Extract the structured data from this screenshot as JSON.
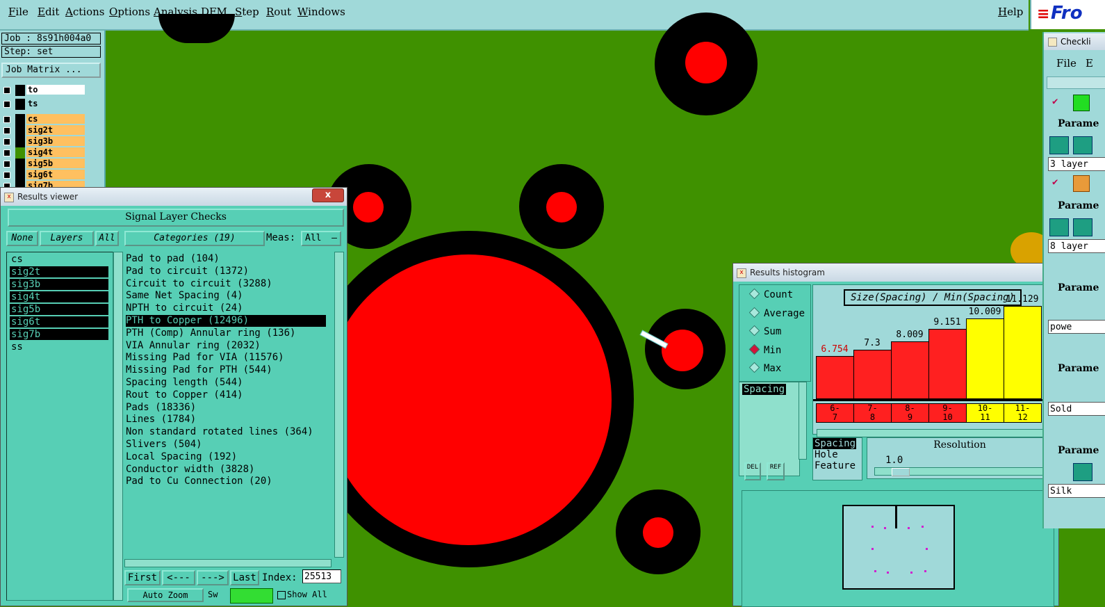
{
  "menu": {
    "items": [
      "File",
      "Edit",
      "Actions",
      "Options",
      "Analysis",
      "DFM",
      "Step",
      "Rout",
      "Windows"
    ],
    "help": "Help"
  },
  "logo": {
    "text": "Fro"
  },
  "job": {
    "job_label": "Job : 8s91h004a0",
    "step_label": "Step: set",
    "matrix_button": "Job Matrix ...",
    "layers": [
      {
        "name": "to",
        "bg": "#ffffff"
      },
      {
        "name": "ts",
        "bg": "#a0d9d9"
      },
      {
        "name": "cs",
        "bg": "#ffc060"
      },
      {
        "name": "sig2t",
        "bg": "#ffc060"
      },
      {
        "name": "sig3b",
        "bg": "#ffc060"
      },
      {
        "name": "sig4t",
        "bg": "#ffc060"
      },
      {
        "name": "sig5b",
        "bg": "#ffc060"
      },
      {
        "name": "sig6t",
        "bg": "#ffc060"
      },
      {
        "name": "sig7b",
        "bg": "#ffc060"
      }
    ]
  },
  "results_viewer": {
    "title": "Results viewer",
    "close": "x",
    "heading": "Signal Layer Checks",
    "none_btn": "None",
    "layers_btn": "Layers",
    "all_btn": "All",
    "categories_btn": "Categories (19)",
    "meas_label": "Meas:",
    "meas_value": "All",
    "layer_list": [
      {
        "name": "cs",
        "selected": false
      },
      {
        "name": "sig2t",
        "selected": true
      },
      {
        "name": "sig3b",
        "selected": true
      },
      {
        "name": "sig4t",
        "selected": true
      },
      {
        "name": "sig5b",
        "selected": true
      },
      {
        "name": "sig6t",
        "selected": true
      },
      {
        "name": "sig7b",
        "selected": true
      },
      {
        "name": "ss",
        "selected": false
      }
    ],
    "categories": [
      {
        "label": "Pad to pad (104)",
        "selected": false
      },
      {
        "label": "Pad to circuit (1372)",
        "selected": false
      },
      {
        "label": "Circuit to circuit (3288)",
        "selected": false
      },
      {
        "label": "Same Net Spacing (4)",
        "selected": false
      },
      {
        "label": "NPTH to circuit (24)",
        "selected": false
      },
      {
        "label": "PTH to Copper (12496)",
        "selected": true
      },
      {
        "label": "PTH (Comp) Annular ring (136)",
        "selected": false
      },
      {
        "label": "VIA Annular ring (2032)",
        "selected": false
      },
      {
        "label": "Missing Pad for VIA (11576)",
        "selected": false
      },
      {
        "label": "Missing Pad for PTH (544)",
        "selected": false
      },
      {
        "label": "Spacing length (544)",
        "selected": false
      },
      {
        "label": "Rout to Copper (414)",
        "selected": false
      },
      {
        "label": "Pads (18336)",
        "selected": false
      },
      {
        "label": "Lines (1784)",
        "selected": false
      },
      {
        "label": "Non standard rotated lines (364)",
        "selected": false
      },
      {
        "label": "Slivers (504)",
        "selected": false
      },
      {
        "label": "Local Spacing (192)",
        "selected": false
      },
      {
        "label": "Conductor width (3828)",
        "selected": false
      },
      {
        "label": "Pad to Cu Connection (20)",
        "selected": false
      }
    ],
    "nav": {
      "first": "First",
      "prev": "<---",
      "next": "--->",
      "last": "Last",
      "index_label": "Index:",
      "index_value": "25513"
    },
    "bottom": {
      "auto_zoom": "Auto Zoom",
      "sw": "Sw",
      "show_all": "Show All"
    }
  },
  "histogram": {
    "title": "Results histogram",
    "close": "x",
    "modes": [
      {
        "label": "Count",
        "on": false
      },
      {
        "label": "Average",
        "on": false
      },
      {
        "label": "Sum",
        "on": false
      },
      {
        "label": "Min",
        "on": true
      },
      {
        "label": "Max",
        "on": false
      }
    ],
    "list_item": "Spacing",
    "del_btn": "DEL",
    "ref_btn": "REF",
    "chart_title": "Size(Spacing) / Min(Spacing)",
    "features": [
      "Spacing",
      "Hole",
      "Feature"
    ],
    "resolution_label": "Resolution",
    "resolution_value": "1.0",
    "colors": {
      "red": "#ff2020",
      "yellow": "#ffff00"
    }
  },
  "chart_data": {
    "type": "bar",
    "title": "Size(Spacing) / Min(Spacing)",
    "categories": [
      "6-7",
      "7-8",
      "8-9",
      "9-10",
      "10-11",
      "11-12"
    ],
    "values": [
      6.754,
      7.3,
      8.009,
      9.151,
      10.009,
      11.129
    ],
    "value_labels": [
      "6.754",
      "7.3",
      "8.009",
      "9.151",
      "10.009",
      "11.129"
    ],
    "bin_labels": [
      [
        "6-",
        "7"
      ],
      [
        "7-",
        "8"
      ],
      [
        "8-",
        "9"
      ],
      [
        "9-",
        "10"
      ],
      [
        "10-",
        "11"
      ],
      [
        "11-",
        "12"
      ]
    ],
    "bar_colors": [
      "#ff2020",
      "#ff2020",
      "#ff2020",
      "#ff2020",
      "#ffff00",
      "#ffff00"
    ],
    "xlabel": "",
    "ylabel": ""
  },
  "checklist": {
    "title": "Checkli",
    "menu": [
      "File",
      "E"
    ],
    "params": [
      "Parame",
      "Parame",
      "Parame",
      "Parame",
      "Parame"
    ],
    "fields": [
      "3 layer",
      "8 layer",
      "powe",
      "Sold",
      "Silk"
    ]
  }
}
